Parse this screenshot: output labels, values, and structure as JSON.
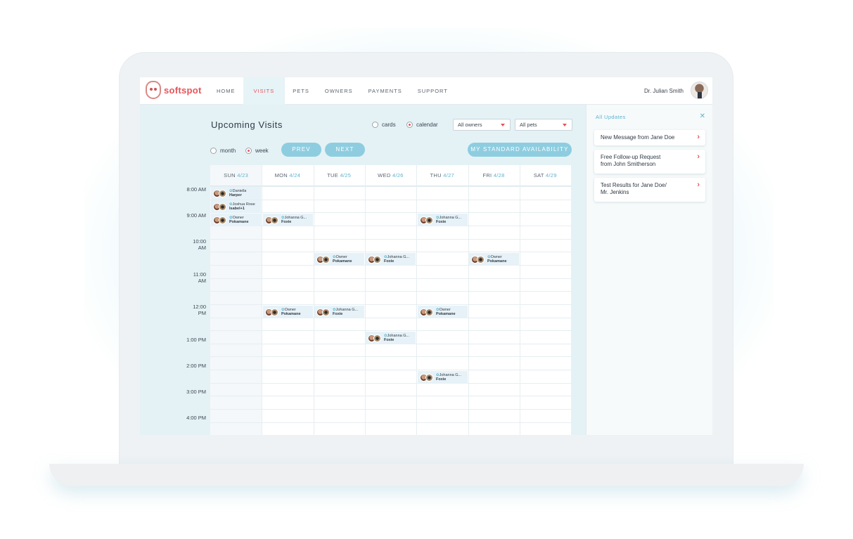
{
  "brand": {
    "name": "softspot",
    "accent": "#e5545a",
    "teal": "#8ecde0"
  },
  "nav": {
    "items": [
      {
        "label": "HOME"
      },
      {
        "label": "VISITS"
      },
      {
        "label": "PETS"
      },
      {
        "label": "OWNERS"
      },
      {
        "label": "PAYMENTS"
      },
      {
        "label": "SUPPORT"
      }
    ],
    "active": "VISITS",
    "user_name": "Dr. Julian Smith"
  },
  "main": {
    "title": "Upcoming Visits",
    "view_toggle": {
      "cards": "cards",
      "calendar": "calendar",
      "selected": "calendar"
    },
    "filters": {
      "owners": "All owners",
      "pets": "All pets"
    },
    "range_toggle": {
      "month": "month",
      "week": "week",
      "selected": "week"
    },
    "buttons": {
      "prev": "PREV",
      "next": "NEXT",
      "availability": "MY STANDARD AVAILABILITY"
    }
  },
  "calendar": {
    "days": [
      {
        "day": "SUN",
        "date": "4/23"
      },
      {
        "day": "MON",
        "date": "4/24"
      },
      {
        "day": "TUE",
        "date": "4/25"
      },
      {
        "day": "WED",
        "date": "4/26"
      },
      {
        "day": "THU",
        "date": "4/27"
      },
      {
        "day": "FRI",
        "date": "4/28"
      },
      {
        "day": "SAT",
        "date": "4/29"
      }
    ],
    "times": [
      "8:00 AM",
      "9:00 AM",
      "10:00 AM",
      "11:00 AM",
      "12:00 PM",
      "1:00 PM",
      "2:00 PM",
      "3:00 PM",
      "4:00 PM"
    ],
    "events": [
      {
        "owner": "Daniella",
        "pet": "Harper"
      },
      {
        "owner": "Joshua Rose",
        "pet": "Isabel+1"
      },
      {
        "owner": "Owner",
        "pet": "Pokamane"
      },
      {
        "owner": "Johanna G...",
        "pet": "Foxie"
      },
      {
        "owner": "Johanna G...",
        "pet": "Foxie"
      },
      {
        "owner": "Owner",
        "pet": "Pokamane"
      },
      {
        "owner": "Johanna G...",
        "pet": "Foxie"
      },
      {
        "owner": "Owner",
        "pet": "Pokamane"
      },
      {
        "owner": "Owner",
        "pet": "Pokamane"
      },
      {
        "owner": "Johanna G...",
        "pet": "Foxie"
      },
      {
        "owner": "Owner",
        "pet": "Pokamane"
      },
      {
        "owner": "Johanna G...",
        "pet": "Foxie"
      },
      {
        "owner": "Johanna G...",
        "pet": "Foxie"
      }
    ]
  },
  "updates": {
    "title": "All Updates",
    "items": [
      {
        "line1": "New Message from Jane Doe",
        "line2": ""
      },
      {
        "line1": "Free Follow-up Request",
        "line2": "from John Smitherson"
      },
      {
        "line1": "Test Results for Jane Doe/",
        "line2": "Mr. Jenkins"
      }
    ]
  }
}
